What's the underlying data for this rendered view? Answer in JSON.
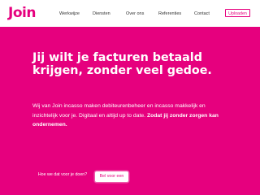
{
  "brand": {
    "logo_text": "Join",
    "accent_color": "#e6007e"
  },
  "nav": {
    "items": [
      {
        "label": "Werkwijze"
      },
      {
        "label": "Diensten"
      },
      {
        "label": "Over ons"
      },
      {
        "label": "Referenties"
      },
      {
        "label": "Contact"
      }
    ],
    "upload_label": "Uploaden"
  },
  "hero": {
    "headline": "Jij wilt je facturen betaald krijgen, zonder veel gedoe.",
    "body_intro": "Wij van Join incasso maken debiteurenbeheer en incasso makkelijk en inzichtelijk voor je. Digitaal en altijd up to date.",
    "body_emphasis": "Zodat jij zonder zorgen kan ondernemen.",
    "cta_secondary": "Hoe we dat voor je doen?",
    "cta_primary": "Bel voor een afspraak"
  }
}
